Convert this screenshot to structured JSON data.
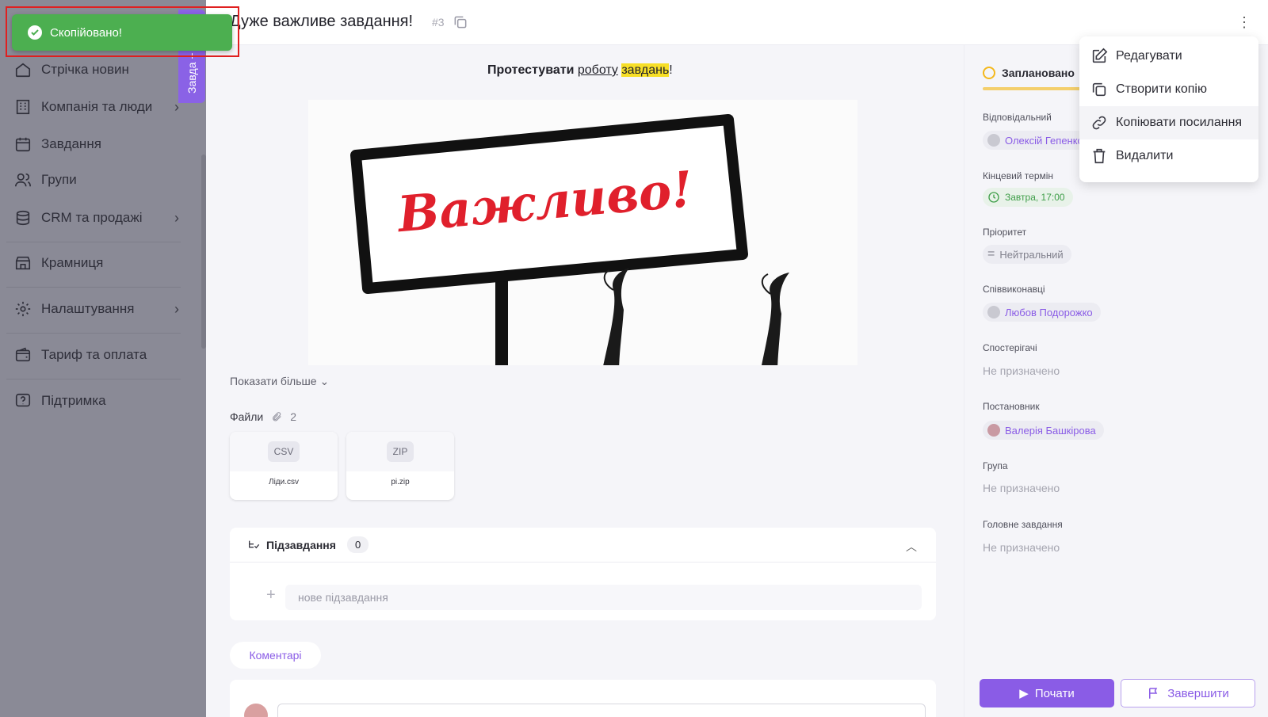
{
  "toast": {
    "text": "Скопійовано!",
    "color": "#4caf50"
  },
  "sidebar": {
    "side_tab": "Завда +",
    "items": [
      {
        "label": "Стрічка новин",
        "icon": "home-icon"
      },
      {
        "label": "Компанія та люди",
        "icon": "building-icon",
        "has_children": true
      },
      {
        "label": "Завдання",
        "icon": "calendar-icon"
      },
      {
        "label": "Групи",
        "icon": "people-icon"
      },
      {
        "label": "CRM та продажі",
        "icon": "stack-icon",
        "has_children": true
      },
      {
        "label": "Крамниця",
        "icon": "store-icon"
      },
      {
        "label": "Налаштування",
        "icon": "gear-icon",
        "has_children": true
      },
      {
        "label": "Тариф та оплата",
        "icon": "wallet-icon"
      },
      {
        "label": "Підтримка",
        "icon": "help-icon"
      }
    ]
  },
  "task": {
    "title": "Дуже важливе завдання!",
    "number": "#3",
    "description": {
      "bold": "Протестувати",
      "underline": "роботу",
      "highlight": "завдань",
      "tail": "!"
    },
    "image_text": "Важливо!",
    "show_more": "Показати більше",
    "files_label": "Файли",
    "files_count": "2",
    "files": [
      {
        "badge": "CSV",
        "name": "Ліди.csv"
      },
      {
        "badge": "ZIP",
        "name": "pi.zip"
      }
    ],
    "subtasks_label": "Підзавдання",
    "subtasks_count": "0",
    "new_subtask_placeholder": "нове підзавдання",
    "comments_tab": "Коментарі"
  },
  "details": {
    "status": "Заплановано",
    "responsible_label": "Відповідальний",
    "responsible": "Олексій Гепенко",
    "deadline_label": "Кінцевий термін",
    "deadline": "Завтра, 17:00",
    "priority_label": "Пріоритет",
    "priority": "Нейтральний",
    "coexecutors_label": "Співвиконавці",
    "coexecutor": "Любов Подорожко",
    "observers_label": "Спостерігачі",
    "observers": "Не призначено",
    "author_label": "Постановник",
    "author": "Валерія Башкірова",
    "group_label": "Група",
    "group": "Не призначено",
    "parent_label": "Головне завдання",
    "parent": "Не призначено",
    "start_button": "Почати",
    "finish_button": "Завершити"
  },
  "menu": {
    "items": [
      {
        "label": "Редагувати",
        "icon": "edit-icon"
      },
      {
        "label": "Створити копію",
        "icon": "duplicate-icon"
      },
      {
        "label": "Копіювати посилання",
        "icon": "link-icon"
      },
      {
        "label": "Видалити",
        "icon": "trash-icon"
      }
    ]
  },
  "colors": {
    "accent": "#8a5ce6",
    "toast": "#4caf50",
    "highlight": "#f7df27",
    "status": "#f4b81c"
  }
}
